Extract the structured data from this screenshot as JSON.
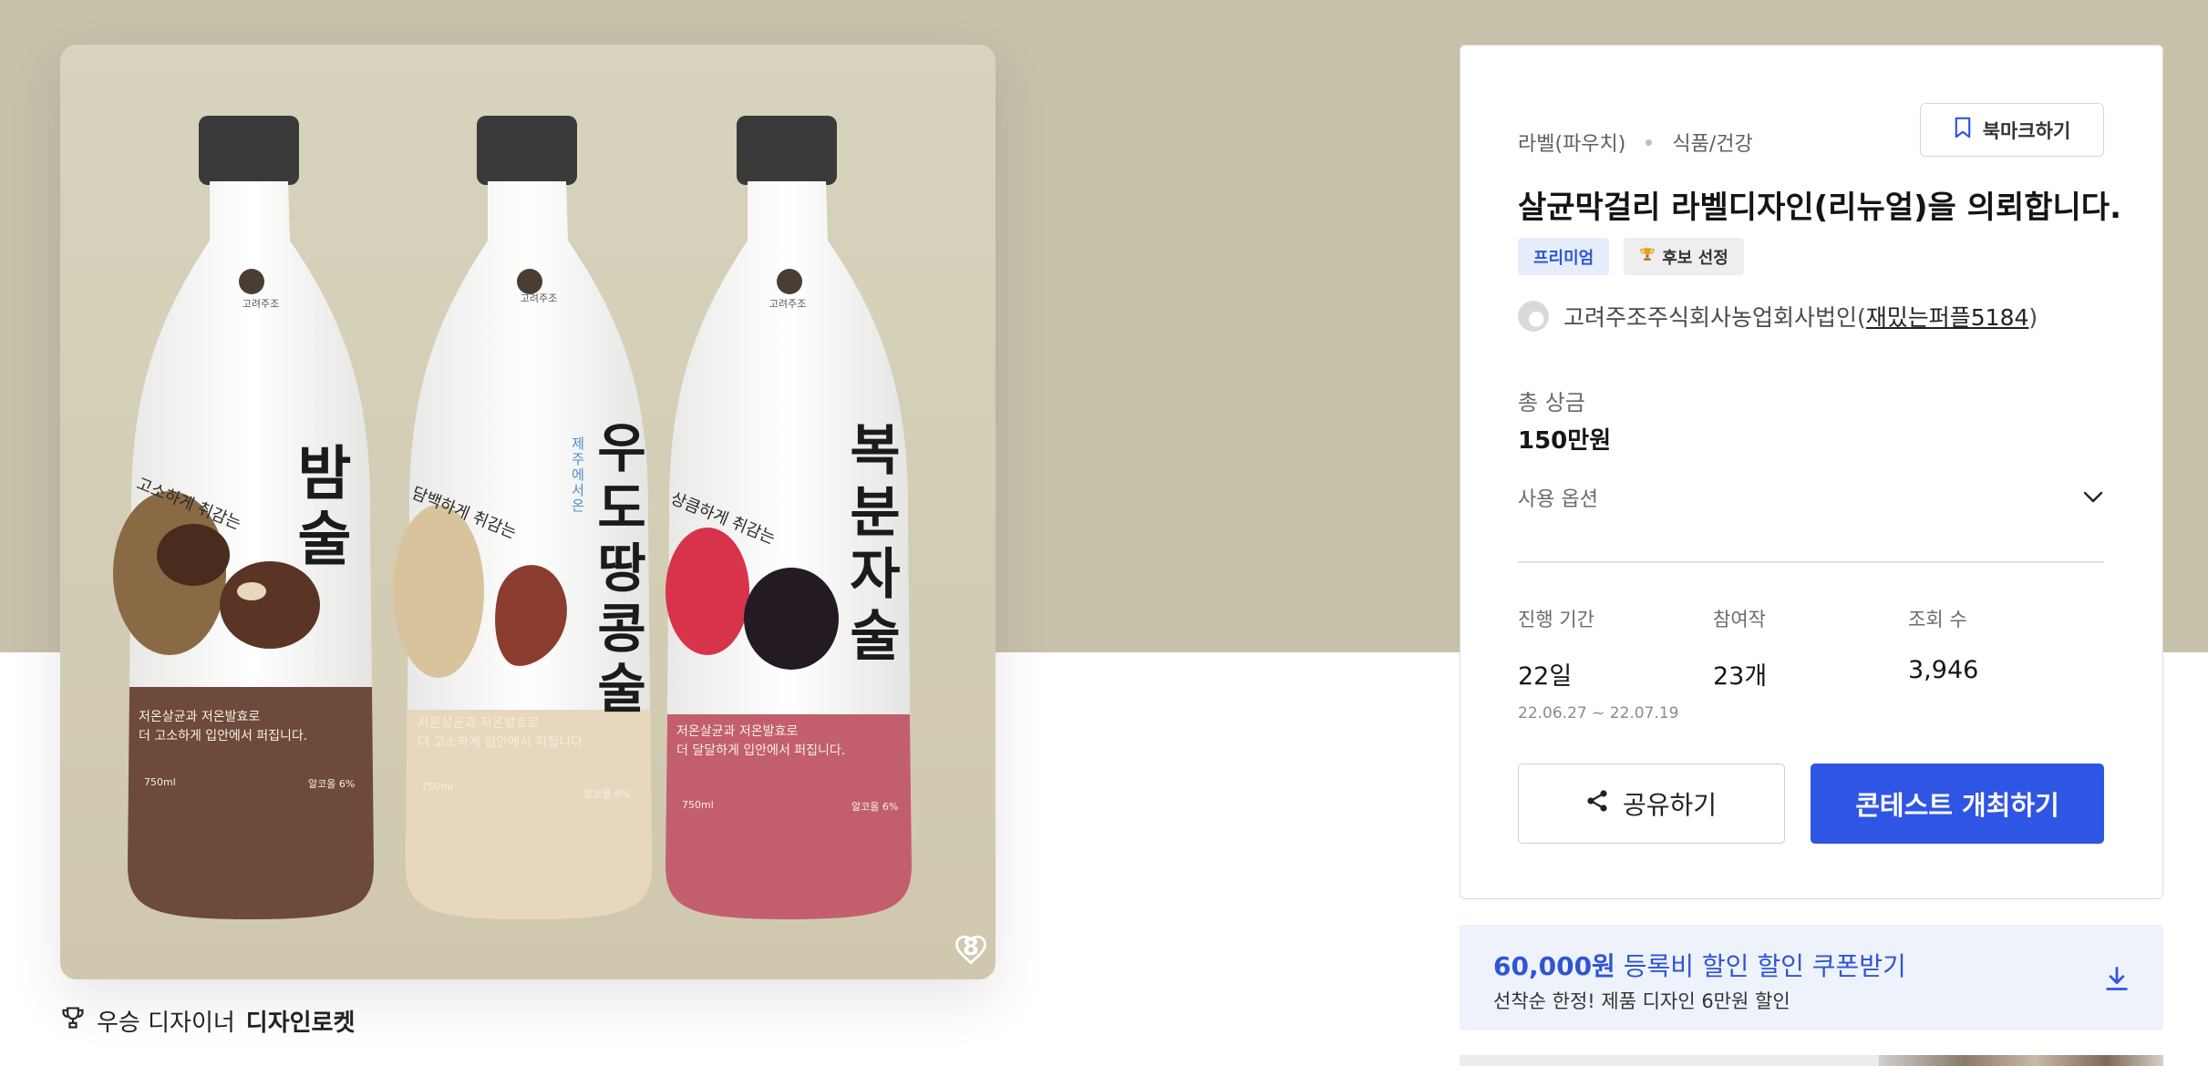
{
  "product": {
    "like_count": "8",
    "bottles": [
      {
        "name": "밤술",
        "tag": "고소하게 취감는",
        "desc": "저온살균과 저온발효로\n더 고소하게 입안에서 퍼집니다.",
        "volume": "750ml",
        "abv": "알코올 6%",
        "brand": "고려주조"
      },
      {
        "name": "우도땅콩술",
        "sub": "제주에서 온",
        "tag": "담백하게 취감는",
        "desc": "저온살균과 저온발효로\n더 고소하게 입안에서 퍼집니다.",
        "volume": "750ml",
        "abv": "알코올 6%",
        "brand": "고려주조"
      },
      {
        "name": "복분자술",
        "tag": "상큼하게 취감는",
        "desc": "저온살균과 저온발효로\n더 달달하게 입안에서 퍼집니다.",
        "volume": "750ml",
        "abv": "알코올 6%",
        "brand": "고려주조"
      }
    ],
    "colors": {
      "chestnut": "#6e4a3a",
      "peanut": "#e7d7bd",
      "berry": "#c35f6d",
      "cap": "#3a3a3a",
      "background": "#c7c1aa"
    }
  },
  "winner": {
    "prefix": "우승 디자이너",
    "name": "디자인로켓",
    "icon": "trophy-icon"
  },
  "contest": {
    "category_primary": "라벨(파우치)",
    "category_secondary": "식품/건강",
    "bookmark_label": "북마크하기",
    "title": "살균막걸리 라벨디자인(리뉴얼)을 의뢰합니다.",
    "badges": {
      "premium": "프리미엄",
      "candidate": "후보 선정"
    },
    "client": {
      "company": "고려주조주식회사농업회사법인",
      "open_paren": "(",
      "nickname": "재밌는퍼플5184",
      "close_paren": ")"
    },
    "prize_label": "총 상금",
    "prize_value": "150만원",
    "options_label": "사용 옵션",
    "stats": {
      "period_label": "진행 기간",
      "period_value": "22일",
      "period_dates": "22.06.27 ~ 22.07.19",
      "participants_label": "참여작",
      "participants_value": "23개",
      "views_label": "조회 수",
      "views_value": "3,946"
    },
    "share_label": "공유하기",
    "host_label": "콘테스트 개최하기",
    "accent_color": "#2f55e4"
  },
  "coupon": {
    "amount": "60,000원",
    "title_rest": " 등록비 할인 할인 쿠폰받기",
    "subtitle": "선착순 한정! 제품 디자인 6만원 할인"
  }
}
